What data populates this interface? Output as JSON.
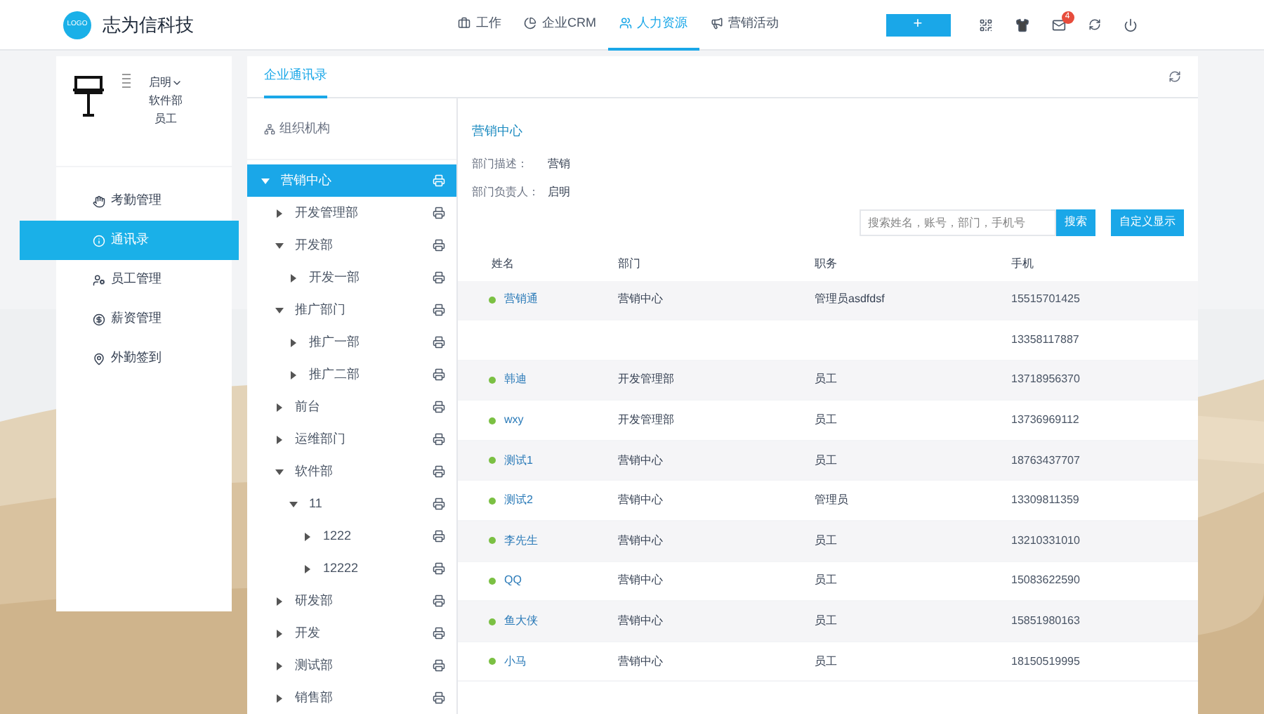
{
  "header": {
    "logo_badge": "LOGO",
    "brand": "志为信科技",
    "nav": [
      {
        "label": "工作",
        "selected": false
      },
      {
        "label": "企业CRM",
        "selected": false
      },
      {
        "label": "人力资源",
        "selected": true
      },
      {
        "label": "营销活动",
        "selected": false
      }
    ],
    "add_button": "+",
    "mail_badge": "4"
  },
  "user": {
    "name": "启明",
    "department": "软件部",
    "role": "员工"
  },
  "sidebar": {
    "items": [
      {
        "label": "考勤管理",
        "selected": false
      },
      {
        "label": "通讯录",
        "selected": true
      },
      {
        "label": "员工管理",
        "selected": false
      },
      {
        "label": "薪资管理",
        "selected": false
      },
      {
        "label": "外勤签到",
        "selected": false
      }
    ]
  },
  "tabs": [
    {
      "label": "企业通讯录",
      "selected": true
    }
  ],
  "tree": {
    "title": "组织机构",
    "items": [
      {
        "label": "营销中心",
        "selected": true,
        "expanded": true,
        "children": [
          {
            "label": "开发管理部",
            "selected": false,
            "expanded": false
          },
          {
            "label": "开发部",
            "selected": false,
            "expanded": true,
            "children": [
              {
                "label": "开发一部",
                "selected": false,
                "expanded": false
              }
            ]
          },
          {
            "label": "推广部门",
            "selected": false,
            "expanded": true,
            "children": [
              {
                "label": "推广一部",
                "selected": false,
                "expanded": false
              },
              {
                "label": "推广二部",
                "selected": false,
                "expanded": false
              }
            ]
          },
          {
            "label": "前台",
            "selected": false,
            "expanded": false
          },
          {
            "label": "运维部门",
            "selected": false,
            "expanded": false
          },
          {
            "label": "软件部",
            "selected": false,
            "expanded": true,
            "children": [
              {
                "label": "11",
                "selected": false,
                "expanded": true,
                "children": [
                  {
                    "label": "1222",
                    "selected": false,
                    "expanded": false
                  },
                  {
                    "label": "12222",
                    "selected": false,
                    "expanded": false
                  }
                ]
              }
            ]
          },
          {
            "label": "研发部",
            "selected": false,
            "expanded": false
          },
          {
            "label": "开发",
            "selected": false,
            "expanded": false
          },
          {
            "label": "测试部",
            "selected": false,
            "expanded": false
          },
          {
            "label": "销售部",
            "selected": false,
            "expanded": false
          }
        ]
      }
    ]
  },
  "department": {
    "title": "营销中心",
    "fields": [
      {
        "label": "部门描述：",
        "value": "营销"
      },
      {
        "label": "部门负责人：",
        "value": "启明"
      }
    ]
  },
  "search": {
    "placeholder": "搜索姓名，账号，部门，手机号",
    "button": "搜索",
    "custom_button": "自定义显示"
  },
  "table": {
    "columns": [
      "姓名",
      "部门",
      "职务",
      "手机"
    ],
    "rows": [
      {
        "name": "营销通",
        "department": "营销中心",
        "position": "管理员asdfdsf",
        "phone": "15515701425"
      },
      {
        "phone": "13358117887"
      },
      {
        "name": "韩迪",
        "department": "开发管理部",
        "position": "员工",
        "phone": "13718956370"
      },
      {
        "name": "wxy",
        "department": "开发管理部",
        "position": "员工",
        "phone": "13736969112"
      },
      {
        "name": "测试1",
        "department": "营销中心",
        "position": "员工",
        "phone": "18763437707"
      },
      {
        "name": "测试2",
        "department": "营销中心",
        "position": "管理员",
        "phone": "13309811359"
      },
      {
        "name": "李先生",
        "department": "营销中心",
        "position": "员工",
        "phone": "13210331010"
      },
      {
        "name": "QQ",
        "department": "营销中心",
        "position": "员工",
        "phone": "15083622590"
      },
      {
        "name": "鱼大侠",
        "department": "营销中心",
        "position": "员工",
        "phone": "15851980163"
      },
      {
        "name": "小马",
        "department": "营销中心",
        "position": "员工",
        "phone": "18150519995"
      }
    ]
  }
}
